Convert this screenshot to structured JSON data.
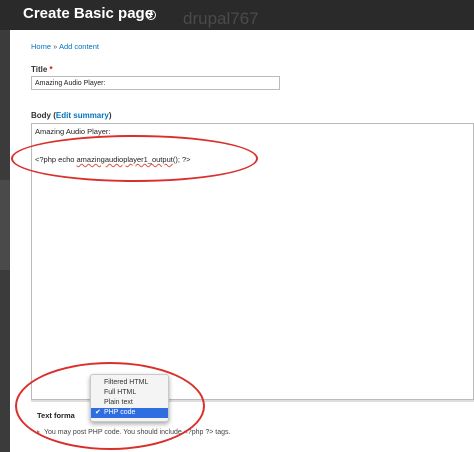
{
  "header": {
    "title": "Create Basic page",
    "watermark": "drupal767",
    "plus_icon": "circle-plus-icon"
  },
  "breadcrumb": {
    "home": "Home",
    "separator": "»",
    "add_content": "Add content"
  },
  "form": {
    "title_label": "Title",
    "required_marker": "*",
    "title_value": "Amazing Audio Player:",
    "body_label": "Body",
    "body_label_open": "(",
    "edit_summary_link": "Edit summary",
    "body_label_close": ")",
    "body_line_1": "Amazing Audio Player:",
    "body_line_2_prefix": "<?php echo ",
    "body_line_2_function": "amazingaudioplayer1_output",
    "body_line_2_suffix": "(); ?>",
    "text_format_label": "Text forma",
    "text_format_hint": "You may post PHP code. You should include <?php ?> tags."
  },
  "text_format_dropdown": {
    "options": [
      "Filtered HTML",
      "Full HTML",
      "Plain text",
      "PHP code"
    ],
    "selected": "PHP code",
    "check_icon": "checkmark-icon"
  },
  "colors": {
    "header_bg": "#2a2a2a",
    "link": "#0074bd",
    "required": "#ee0000",
    "annotation": "#d9302c",
    "selection": "#2f6ee0"
  }
}
